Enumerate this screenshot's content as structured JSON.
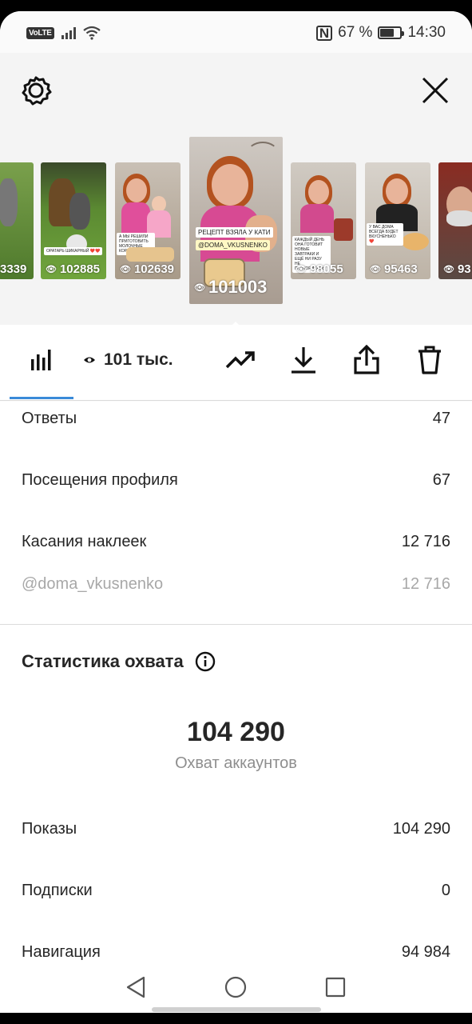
{
  "status": {
    "network": "VoLTE",
    "battery": "67 %",
    "battery_level": 0.67,
    "time": "14:30"
  },
  "stories": [
    {
      "views": "3339"
    },
    {
      "views": "102885",
      "caption": "ОРАТАРЬ ШИКАРНЫЙ ❤️❤️"
    },
    {
      "views": "102639",
      "caption": "А МЫ РЕШИЛИ ПРИГОТОВИТЬ МОЛОЧНЫЕ КОРЖИКИ ❤️"
    },
    {
      "views": "101003",
      "caption_1": "РЕЦЕПТ ВЗЯЛА У КАТИ",
      "caption_2": "@DOMA_VKUSNENKO"
    },
    {
      "views": "98055",
      "caption": "КАЖДЫЙ ДЕНЬ ОНА ГОТОВИТ НОВЫЕ ЗАВТРАКИ И ЕЩЁ НИ РАЗУ НЕ ПОВТОРИЛАСЬ"
    },
    {
      "views": "95463",
      "caption": "У ВАС ДОМА ВСЕГДА БУДЕТ ВКУСНЕНЬКО ❤️"
    },
    {
      "views": "93"
    }
  ],
  "toolbar": {
    "views_label": "101 тыс."
  },
  "metrics": [
    {
      "label": "Ответы",
      "value": "47"
    },
    {
      "label": "Посещения профиля",
      "value": "67"
    },
    {
      "label": "Касания наклеек",
      "value": "12 716"
    }
  ],
  "sticker": {
    "label": "@doma_vkusnenko",
    "value": "12 716"
  },
  "reach": {
    "title": "Статистика охвата",
    "number": "104 290",
    "subtitle": "Охват аккаунтов",
    "rows": [
      {
        "label": "Показы",
        "value": "104 290"
      },
      {
        "label": "Подписки",
        "value": "0"
      },
      {
        "label": "Навигация",
        "value": "94 984"
      }
    ]
  },
  "colors": {
    "tab_accent": "#3a8ad8",
    "text": "#262626",
    "muted": "#a8a8a8"
  }
}
